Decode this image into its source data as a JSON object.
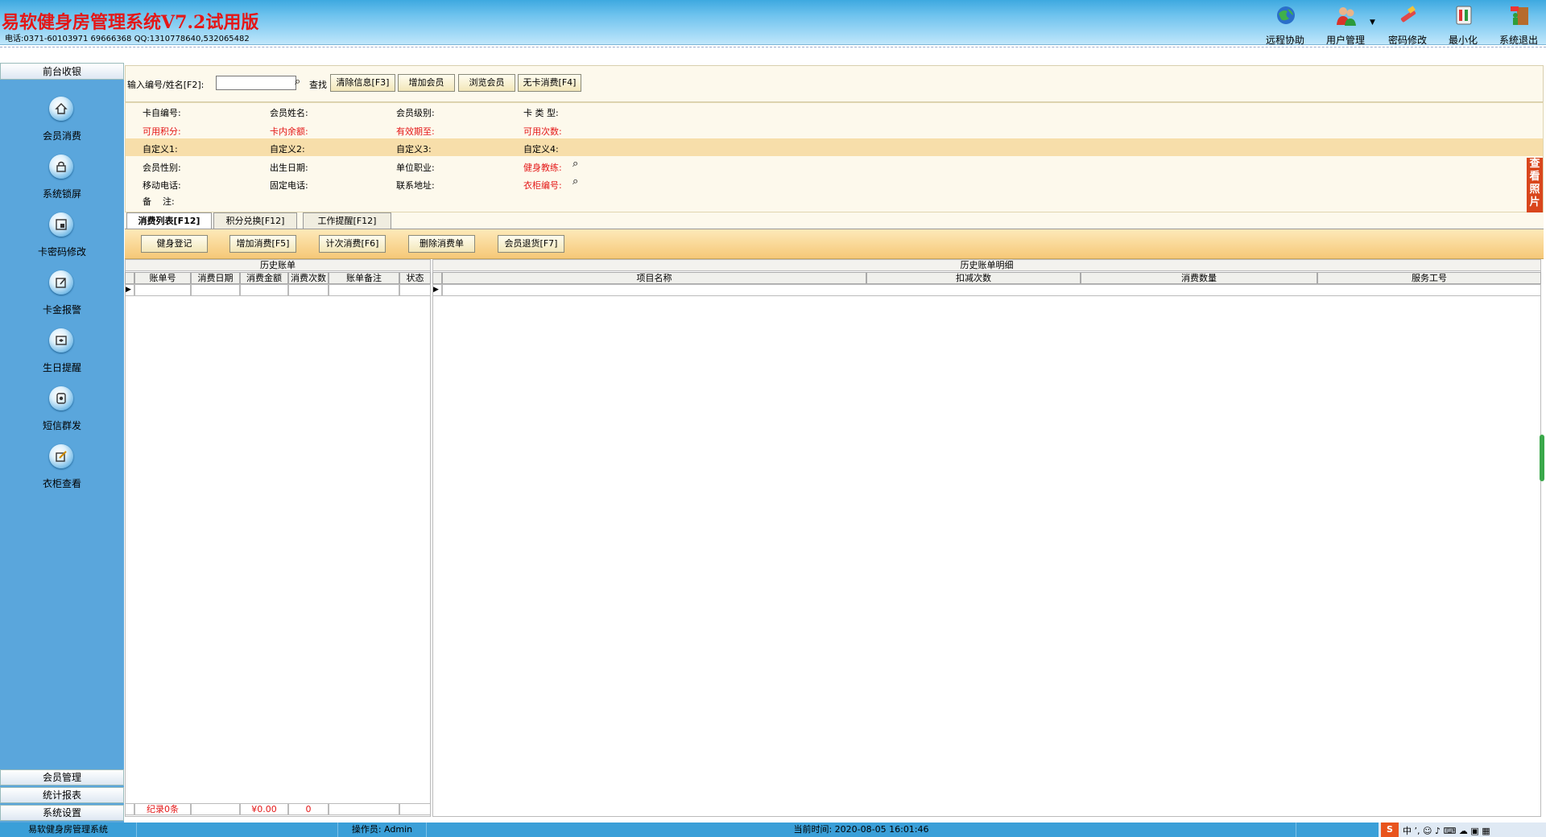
{
  "header": {
    "title": "易软健身房管理系统V7.2试用版",
    "contact": "电话:0371-60103971  69666368 QQ:1310778640,532065482",
    "toolbar": [
      {
        "label": "远程协助",
        "icon": "globe-icon"
      },
      {
        "label": "用户管理",
        "icon": "users-icon"
      },
      {
        "label": "密码修改",
        "icon": "key-icon"
      },
      {
        "label": "最小化",
        "icon": "minimize-icon"
      },
      {
        "label": "系统退出",
        "icon": "exit-icon"
      }
    ]
  },
  "sidebar": {
    "section": "前台收银",
    "items": [
      {
        "label": "会员消费",
        "icon": "house-icon"
      },
      {
        "label": "系统锁屏",
        "icon": "lock-icon"
      },
      {
        "label": "卡密码修改",
        "icon": "card-icon"
      },
      {
        "label": "卡金报警",
        "icon": "edit-icon"
      },
      {
        "label": "生日提醒",
        "icon": "gift-icon"
      },
      {
        "label": "短信群发",
        "icon": "sms-icon"
      },
      {
        "label": "衣柜查看",
        "icon": "pencil-icon"
      }
    ],
    "bottom": [
      "会员管理",
      "统计报表",
      "系统设置"
    ]
  },
  "search": {
    "label": "输入编号/姓名[F2]:",
    "value": "",
    "find_label": "查找",
    "buttons": [
      "清除信息[F3]",
      "增加会员",
      "浏览会员",
      "无卡消费[F4]"
    ]
  },
  "info": {
    "row1": [
      "卡自编号:",
      "会员姓名:",
      "会员级别:",
      "卡 类 型:"
    ],
    "row2": [
      "可用积分:",
      "卡内余额:",
      "有效期至:",
      "可用次数:"
    ],
    "row3": [
      "自定义1:",
      "自定义2:",
      "自定义3:",
      "自定义4:"
    ],
    "row4": [
      "会员性别:",
      "出生日期:",
      "单位职业:",
      "健身教练:"
    ],
    "row5": [
      "移动电话:",
      "固定电话:",
      "联系地址:",
      "衣柜编号:"
    ],
    "row6": [
      "备    注:"
    ],
    "photo_label": "查看照片"
  },
  "tabs": [
    "消费列表[F12]",
    "积分兑换[F12]",
    "工作提醒[F12]"
  ],
  "actions": [
    "健身登记",
    "增加消费[F5]",
    "计次消费[F6]",
    "删除消费单",
    "会员退货[F7]"
  ],
  "history": {
    "title": "历史账单",
    "columns": [
      "账单号",
      "消费日期",
      "消费金额",
      "消费次数",
      "账单备注",
      "状态"
    ],
    "footer": {
      "records": "纪录0条",
      "amount": "¥0.00",
      "count": "0"
    }
  },
  "detail": {
    "title": "历史账单明细",
    "columns": [
      "项目名称",
      "扣减次数",
      "消费数量",
      "服务工号"
    ]
  },
  "status": {
    "app": "易软健身房管理系统",
    "operator": "操作员: Admin",
    "time": "当前时间: 2020-08-05 16:01:46"
  }
}
